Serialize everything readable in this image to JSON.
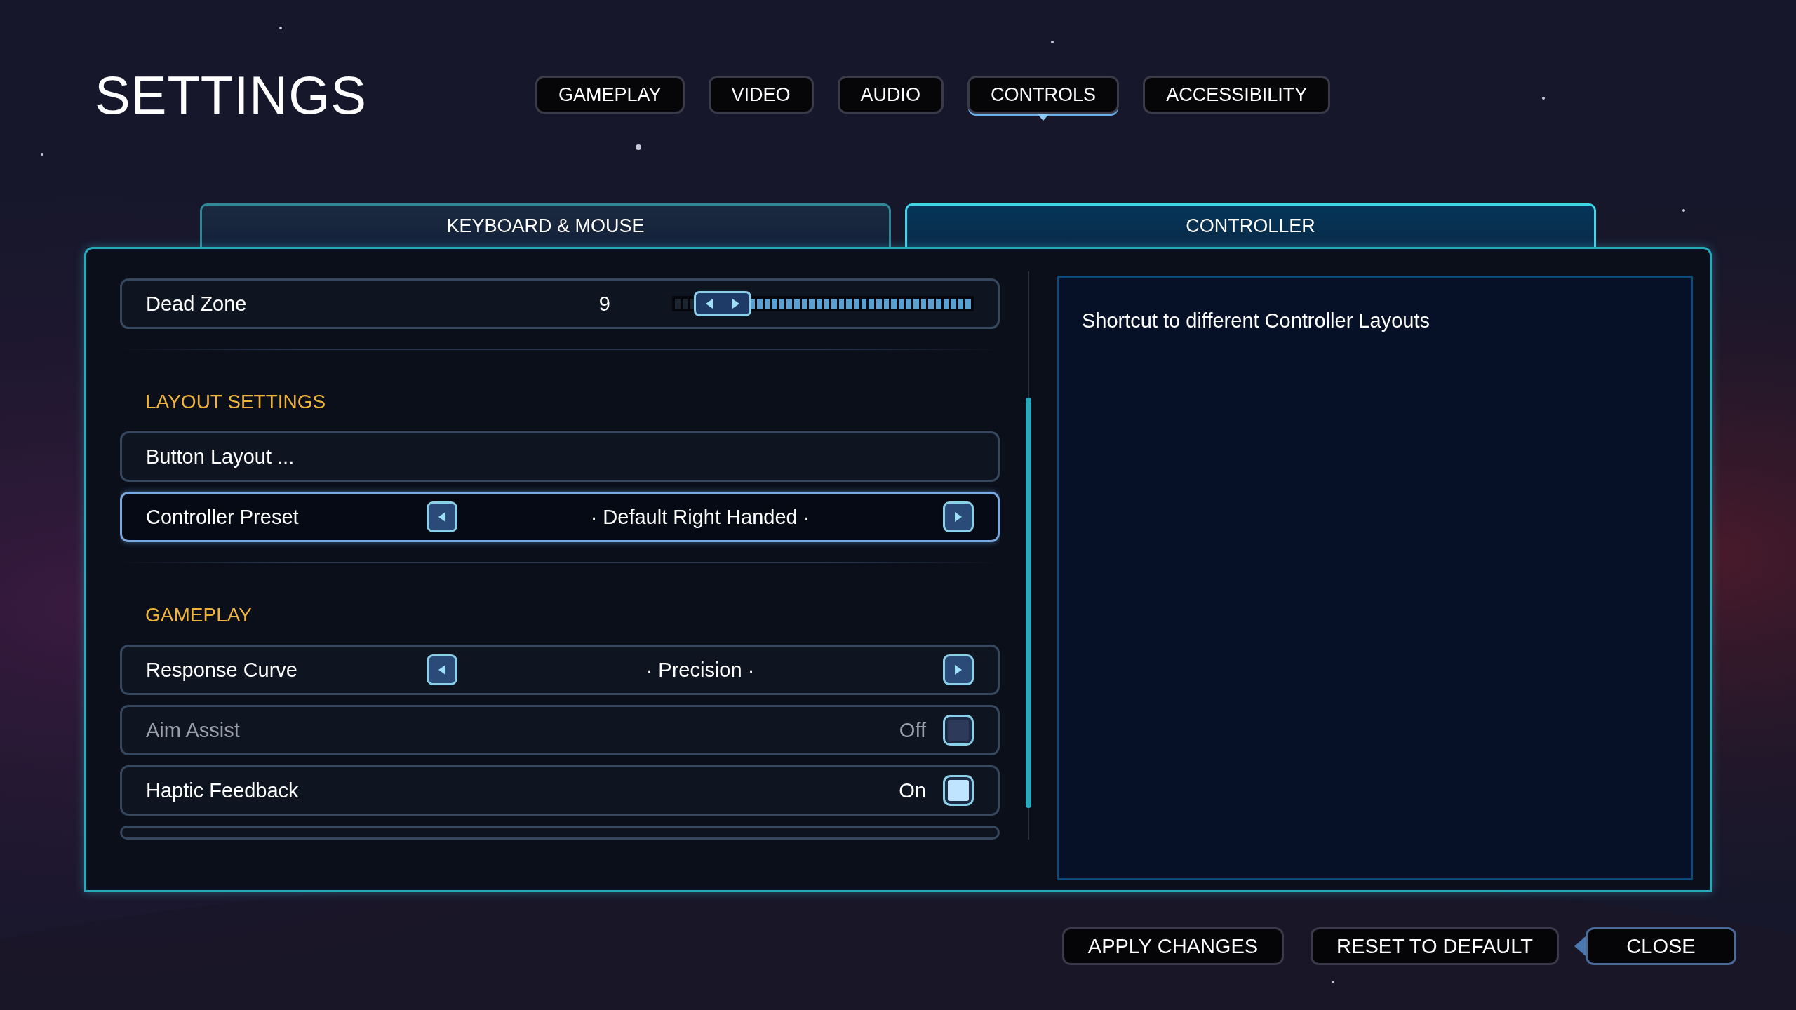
{
  "title": "SETTINGS",
  "tabs": [
    {
      "label": "GAMEPLAY",
      "selected": false
    },
    {
      "label": "VIDEO",
      "selected": false
    },
    {
      "label": "AUDIO",
      "selected": false
    },
    {
      "label": "CONTROLS",
      "selected": true
    },
    {
      "label": "ACCESSIBILITY",
      "selected": false
    }
  ],
  "subtabs": [
    {
      "label": "KEYBOARD & MOUSE",
      "selected": false
    },
    {
      "label": "CONTROLLER",
      "selected": true
    }
  ],
  "rows": [
    {
      "kind": "slider",
      "label": "Dead Zone",
      "value": "9",
      "level": 0.09,
      "selected": false
    },
    {
      "kind": "section",
      "label": "LAYOUT SETTINGS"
    },
    {
      "kind": "link",
      "label": "Button Layout ...",
      "selected": false
    },
    {
      "kind": "selector",
      "label": "Controller Preset",
      "value": "· Default Right Handed ·",
      "selected": true
    },
    {
      "kind": "section",
      "label": "GAMEPLAY"
    },
    {
      "kind": "selector",
      "label": "Response Curve",
      "value": "· Precision ·",
      "selected": false
    },
    {
      "kind": "toggle",
      "label": "Aim Assist",
      "value": "Off",
      "on": false,
      "disabled": true,
      "selected": false
    },
    {
      "kind": "toggle",
      "label": "Haptic Feedback",
      "value": "On",
      "on": true,
      "disabled": false,
      "selected": false
    },
    {
      "kind": "blank",
      "selected": false
    }
  ],
  "description": "Shortcut to different Controller Layouts",
  "buttons": [
    {
      "label": "APPLY CHANGES",
      "selected": false
    },
    {
      "label": "RESET TO DEFAULT",
      "selected": false
    },
    {
      "label": "CLOSE",
      "selected": true
    }
  ]
}
